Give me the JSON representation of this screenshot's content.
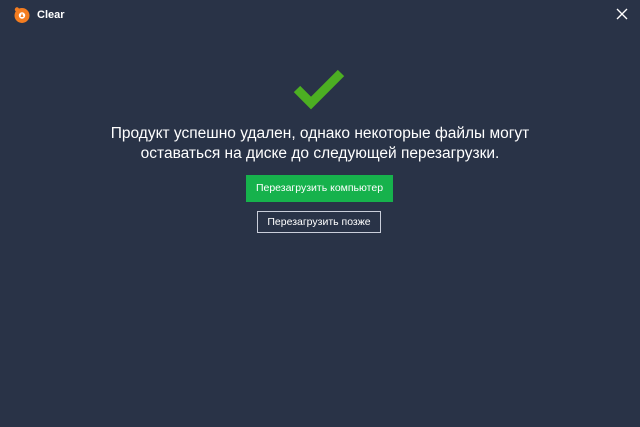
{
  "window": {
    "title": "Clear"
  },
  "icons": {
    "logo": "avast-logo-icon",
    "close": "close-icon",
    "success": "checkmark-icon"
  },
  "message": {
    "line1": "Продукт успешно удален, однако некоторые файлы могут",
    "line2": "оставаться на диске до следующей перезагрузки."
  },
  "buttons": {
    "restart_now": "Перезагрузить компьютер",
    "restart_later": "Перезагрузить позже"
  },
  "colors": {
    "background": "#293347",
    "accent_green": "#16b24c",
    "check_green": "#4caf22",
    "logo_orange": "#f47d20"
  }
}
